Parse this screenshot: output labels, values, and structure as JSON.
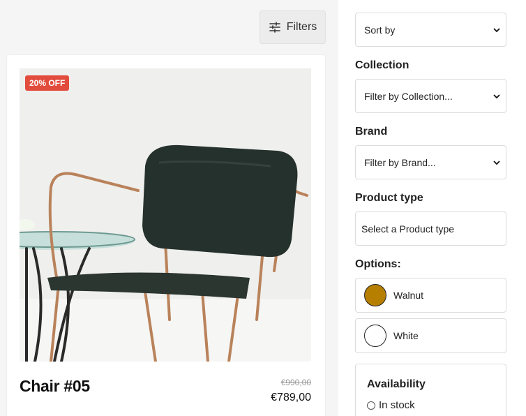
{
  "toolbar": {
    "filters_label": "Filters"
  },
  "product": {
    "badge": "20% OFF",
    "title": "Chair #05",
    "price_old": "€990,00",
    "price_new": "€789,00"
  },
  "sidebar": {
    "sort_by": "Sort by",
    "collection": {
      "label": "Collection",
      "value": "Filter by Collection..."
    },
    "brand": {
      "label": "Brand",
      "value": "Filter by Brand..."
    },
    "product_type": {
      "label": "Product type",
      "value": "Select a Product type"
    },
    "options": {
      "label": "Options:",
      "items": [
        {
          "label": "Walnut",
          "color": "#b77f00"
        },
        {
          "label": "White",
          "color": "#ffffff"
        }
      ]
    },
    "availability": {
      "title": "Availability",
      "in_stock": "In stock"
    }
  },
  "colors": {
    "badge": "#e24c3c",
    "accent": "#b77f00"
  }
}
